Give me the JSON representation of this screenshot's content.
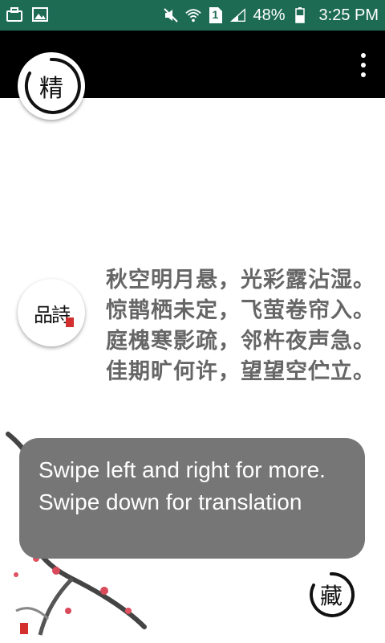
{
  "status_bar": {
    "battery": "48%",
    "time": "3:25 PM",
    "sim_slot": "1"
  },
  "app_bar": {
    "logo_char": "精"
  },
  "poem": {
    "badge_text": "品詩",
    "text": "秋空明月悬，光彩露沾湿。 惊鹊栖未定，飞萤卷帘入。 庭槐寒影疏，邻杵夜声急。 佳期旷何许，望望空伫立。"
  },
  "toast": {
    "message": "Swipe left and right for more. Swipe down for translation"
  },
  "collect": {
    "char": "藏"
  },
  "colors": {
    "status_bar": "#1e6b54",
    "app_bar": "#000000",
    "toast_bg": "#767676",
    "poem_text": "#666666",
    "seal_red": "#d32f2f"
  },
  "icons": {
    "status_left": [
      "briefcase-icon",
      "image-icon"
    ],
    "status_right": [
      "mute-icon",
      "wifi-icon",
      "sim-icon",
      "signal-icon",
      "battery-icon"
    ]
  }
}
